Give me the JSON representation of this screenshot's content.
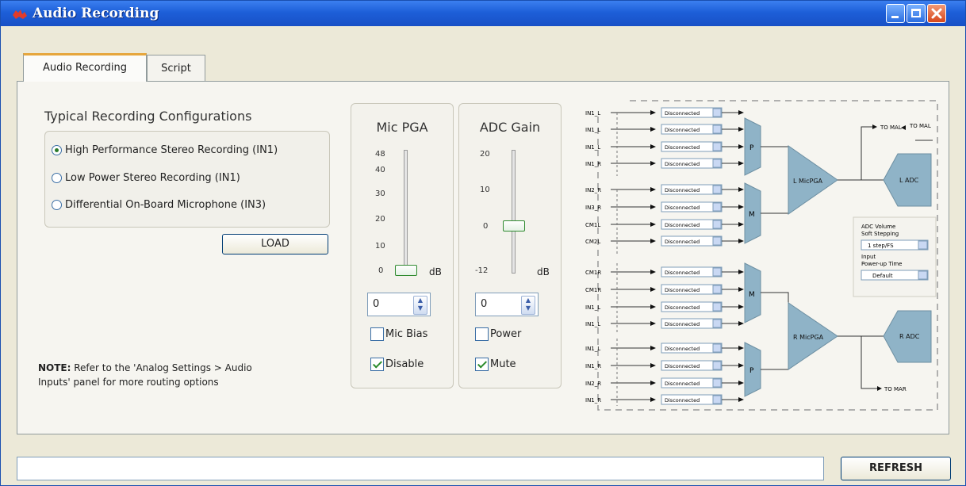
{
  "window": {
    "title": "Audio Recording"
  },
  "tabs": [
    {
      "label": "Audio Recording",
      "active": true
    },
    {
      "label": "Script",
      "active": false
    }
  ],
  "configs": {
    "heading": "Typical Recording Configurations",
    "options": [
      {
        "label": "High Performance Stereo Recording (IN1)",
        "selected": true
      },
      {
        "label": "Low Power Stereo Recording (IN1)",
        "selected": false
      },
      {
        "label": "Differential On-Board Microphone (IN3)",
        "selected": false
      }
    ],
    "load_label": "LOAD"
  },
  "note": {
    "bold": "NOTE:",
    "text": " Refer to the 'Analog Settings > Audio Inputs' panel for more routing options"
  },
  "mic_pga": {
    "title": "Mic PGA",
    "ticks": [
      "48",
      "40",
      "30",
      "20",
      "10",
      "0"
    ],
    "unit": "dB",
    "value": "0",
    "check1": {
      "label": "Mic Bias",
      "checked": false
    },
    "check2": {
      "label": "Disable",
      "checked": true
    }
  },
  "adc_gain": {
    "title": "ADC Gain",
    "ticks": [
      "20",
      "10",
      "0",
      "-12"
    ],
    "unit": "dB",
    "value": "0",
    "check1": {
      "label": "Power",
      "checked": false
    },
    "check2": {
      "label": "Mute",
      "checked": true
    }
  },
  "diagram": {
    "top_inputs_a": [
      "IN1_L",
      "IN1_L",
      "IN1_L",
      "IN1_R"
    ],
    "top_inputs_b": [
      "IN2_R",
      "IN3_R",
      "CM1L",
      "CM2L"
    ],
    "bot_inputs_a": [
      "CM1R",
      "CM1R",
      "IN1_L",
      "IN1_L"
    ],
    "bot_inputs_b": [
      "IN1_L",
      "IN1_R",
      "IN2_R",
      "IN1_R"
    ],
    "mux_option": "Disconnected",
    "mux_p": "P",
    "mux_m": "M",
    "left_pga": "L MicPGA",
    "right_pga": "R MicPGA",
    "left_adc": "L ADC",
    "right_adc": "R ADC",
    "to_top_short": "TO MAL",
    "to_top_long": "TO MAL",
    "to_bottom": "TO MAR",
    "adc_volume_label_1": "ADC Volume",
    "adc_volume_label_2": "Soft Stepping",
    "adc_volume_value": "1 step/FS",
    "power_up_label_1": "Input",
    "power_up_label_2": "Power-up Time",
    "power_up_value": "Default"
  },
  "refresh_label": "REFRESH"
}
